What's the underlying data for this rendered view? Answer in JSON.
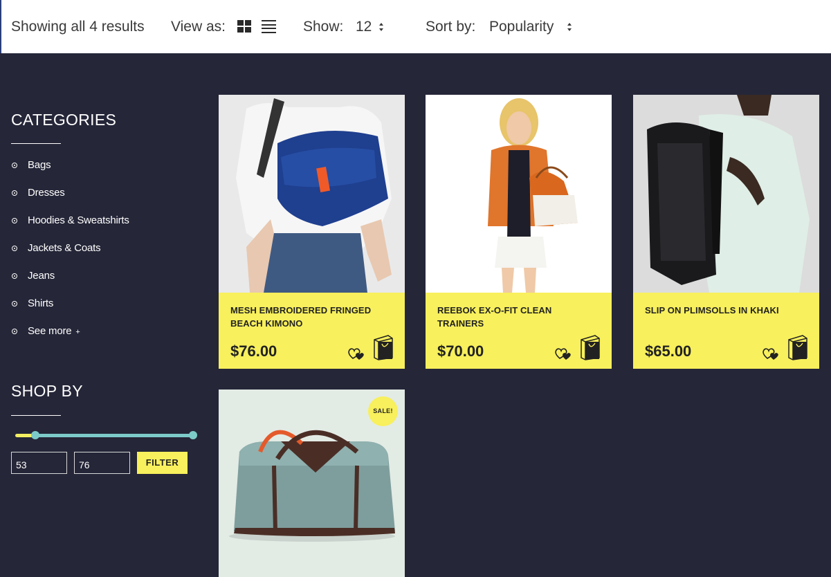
{
  "toolbar": {
    "results_text": "Showing all 4 results",
    "view_label": "View as:",
    "show_label": "Show:",
    "show_value": "12",
    "sort_label": "Sort by:",
    "sort_value": "Popularity"
  },
  "sidebar": {
    "categories_title": "CATEGORIES",
    "categories": [
      {
        "label": "Bags"
      },
      {
        "label": "Dresses"
      },
      {
        "label": "Hoodies & Sweatshirts"
      },
      {
        "label": "Jackets & Coats"
      },
      {
        "label": "Jeans"
      },
      {
        "label": "Shirts"
      },
      {
        "label": "See more",
        "suffix": "+"
      }
    ],
    "shopby_title": "SHOP BY",
    "price_filter": {
      "min_value": "53",
      "max_value": "76",
      "button_label": "FILTER"
    }
  },
  "products": [
    {
      "name": "MESH EMBROIDERED FRINGED BEACH KIMONO",
      "price": "$76.00",
      "image_icon": "messenger-bag-photo"
    },
    {
      "name": "REEBOK EX-O-FIT CLEAN TRAINERS",
      "price": "$70.00",
      "image_icon": "woman-with-handbag-photo"
    },
    {
      "name": "SLIP ON PLIMSOLLS IN KHAKI",
      "price": "$65.00",
      "image_icon": "backpack-photo"
    },
    {
      "sale_badge": "SALE!",
      "image_icon": "duffel-bag-photo"
    }
  ],
  "colors": {
    "page_bg": "#252638",
    "card_yellow": "#f8f05c",
    "slider_teal": "#7dcbc9"
  }
}
